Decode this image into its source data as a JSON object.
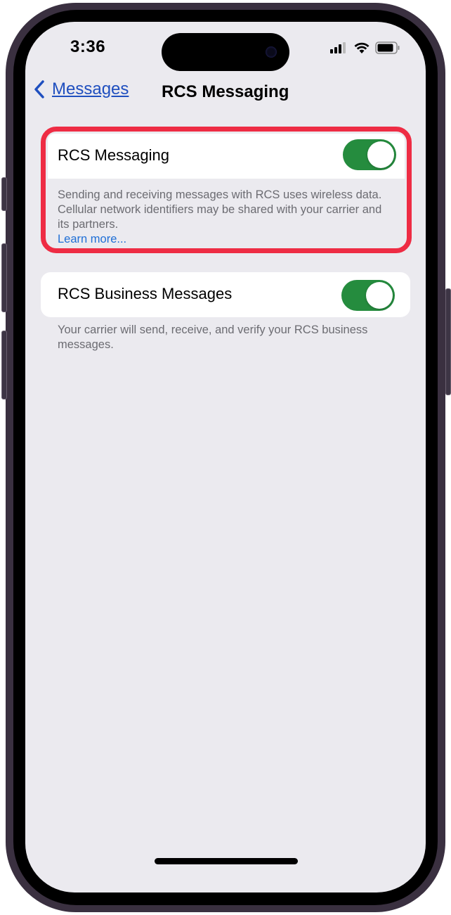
{
  "status_bar": {
    "time": "3:36",
    "icons": [
      "cellular-signal-icon",
      "wifi-icon",
      "battery-icon"
    ]
  },
  "nav": {
    "back_label": "Messages",
    "title": "RCS Messaging"
  },
  "settings": [
    {
      "label": "RCS Messaging",
      "enabled": true,
      "footer": "Sending and receiving messages with RCS uses wireless data. Cellular network identifiers may be shared with your carrier and its partners.",
      "link": "Learn more..."
    },
    {
      "label": "RCS Business Messages",
      "enabled": true,
      "footer": "Your carrier will send, receive, and verify your RCS business messages."
    }
  ],
  "colors": {
    "accent": "#1f4fbf",
    "toggle_on": "#258c3e",
    "highlight": "#ee2c44",
    "background": "#ebeaef"
  }
}
